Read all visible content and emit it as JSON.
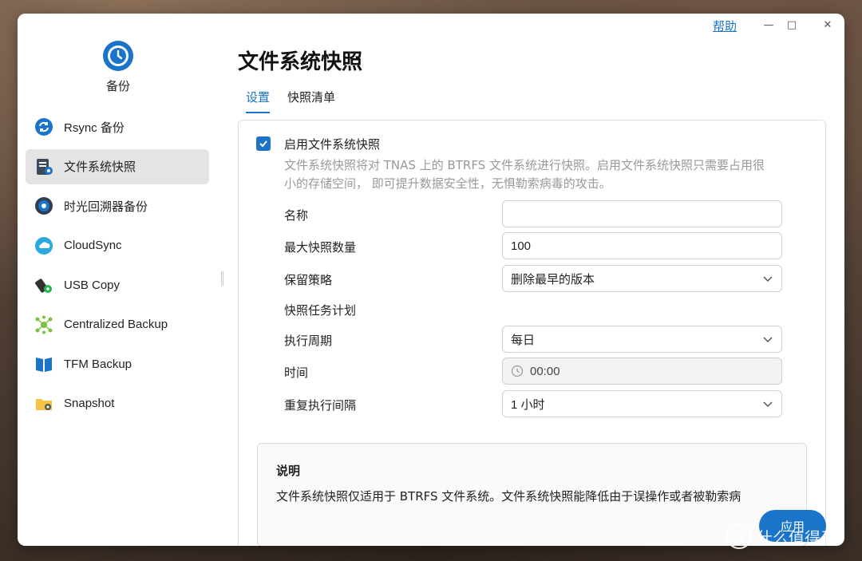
{
  "window": {
    "help_label": "帮助",
    "minimize": "—",
    "maximize": "□",
    "close": "✕"
  },
  "sidebar": {
    "app_name": "备份",
    "app_icon": "backup-clock-icon",
    "items": [
      {
        "label": "Rsync 备份",
        "icon": "rsync-icon",
        "active": false
      },
      {
        "label": "文件系统快照",
        "icon": "filesystem-snapshot-icon",
        "active": true
      },
      {
        "label": "时光回溯器备份",
        "icon": "time-machine-icon",
        "active": false
      },
      {
        "label": "CloudSync",
        "icon": "cloudsync-icon",
        "active": false
      },
      {
        "label": "USB Copy",
        "icon": "usb-icon",
        "active": false
      },
      {
        "label": "Centralized Backup",
        "icon": "centralized-backup-icon",
        "active": false
      },
      {
        "label": "TFM Backup",
        "icon": "tfm-backup-icon",
        "active": false
      },
      {
        "label": "Snapshot",
        "icon": "snapshot-folder-icon",
        "active": false
      }
    ]
  },
  "main": {
    "title": "文件系统快照",
    "tabs": [
      {
        "label": "设置",
        "active": true
      },
      {
        "label": "快照清单",
        "active": false
      }
    ],
    "enable_label": "启用文件系统快照",
    "enable_checked": true,
    "description_line1": "文件系统快照将对 TNAS 上的 BTRFS 文件系统进行快照。启用文件系统快照只需要占用很",
    "description_line2": "小的存储空间， 即可提升数据安全性，无惧勒索病毒的攻击。",
    "fields": {
      "name_label": "名称",
      "name_value": "",
      "max_label": "最大快照数量",
      "max_value": "100",
      "retention_label": "保留策略",
      "retention_value": "删除最早的版本",
      "schedule_label": "快照任务计划",
      "period_label": "执行周期",
      "period_value": "每日",
      "time_label": "时间",
      "time_value": "00:00",
      "interval_label": "重复执行间隔",
      "interval_value": "1 小时"
    },
    "note": {
      "title": "说明",
      "text": "文件系统快照仅适用于 BTRFS 文件系统。文件系统快照能降低由于误操作或者被勒索病"
    },
    "apply_label": "应用"
  },
  "watermark": {
    "glyph": "值",
    "text": "什么值得买"
  },
  "colors": {
    "accent": "#1a74c9",
    "sidebar_active": "#e4e4e4"
  }
}
